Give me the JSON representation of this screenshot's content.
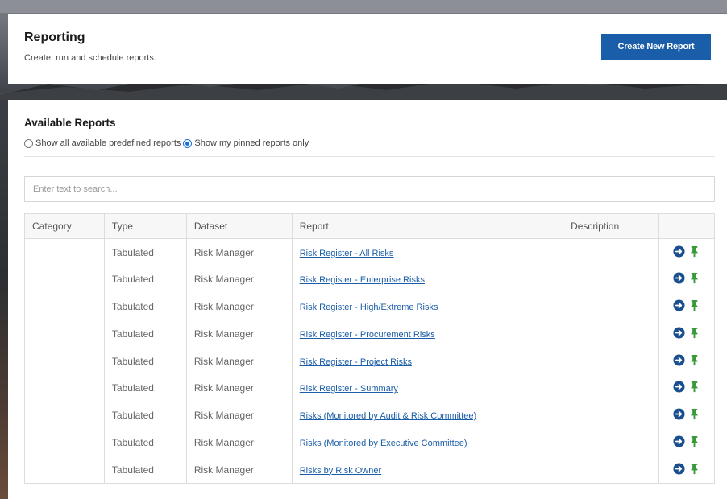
{
  "header": {
    "title": "Reporting",
    "subtitle": "Create, run and schedule reports.",
    "create_button_label": "Create New Report"
  },
  "available_reports": {
    "title": "Available Reports",
    "filter_options": [
      {
        "label": "Show all available predefined reports",
        "selected": false
      },
      {
        "label": "Show my pinned reports only",
        "selected": true
      }
    ]
  },
  "search": {
    "placeholder": "Enter text to search...",
    "value": ""
  },
  "table": {
    "columns": [
      "Category",
      "Type",
      "Dataset",
      "Report",
      "Description",
      ""
    ],
    "rows": [
      {
        "category": "",
        "type": "Tabulated",
        "dataset": "Risk Manager",
        "report": "Risk Register - All Risks",
        "description": ""
      },
      {
        "category": "",
        "type": "Tabulated",
        "dataset": "Risk Manager",
        "report": "Risk Register - Enterprise Risks",
        "description": ""
      },
      {
        "category": "",
        "type": "Tabulated",
        "dataset": "Risk Manager",
        "report": "Risk Register - High/Extreme Risks",
        "description": ""
      },
      {
        "category": "",
        "type": "Tabulated",
        "dataset": "Risk Manager",
        "report": "Risk Register - Procurement Risks",
        "description": ""
      },
      {
        "category": "",
        "type": "Tabulated",
        "dataset": "Risk Manager",
        "report": "Risk Register - Project Risks",
        "description": ""
      },
      {
        "category": "",
        "type": "Tabulated",
        "dataset": "Risk Manager",
        "report": "Risk Register - Summary",
        "description": ""
      },
      {
        "category": "",
        "type": "Tabulated",
        "dataset": "Risk Manager",
        "report": "Risks (Monitored by Audit & Risk Committee)",
        "description": ""
      },
      {
        "category": "",
        "type": "Tabulated",
        "dataset": "Risk Manager",
        "report": "Risks (Monitored by Executive Committee)",
        "description": ""
      },
      {
        "category": "",
        "type": "Tabulated",
        "dataset": "Risk Manager",
        "report": "Risks by Risk Owner",
        "description": ""
      }
    ],
    "row_actions": [
      {
        "icon": "arrow-right-circle-icon",
        "color": "#1a4f8f"
      },
      {
        "icon": "pin-icon",
        "color": "#3a9a3a"
      }
    ]
  },
  "colors": {
    "primary": "#1a5da8",
    "link": "#1a5da8",
    "pin_green": "#3a9a3a",
    "run_navy": "#1a4f8f"
  }
}
